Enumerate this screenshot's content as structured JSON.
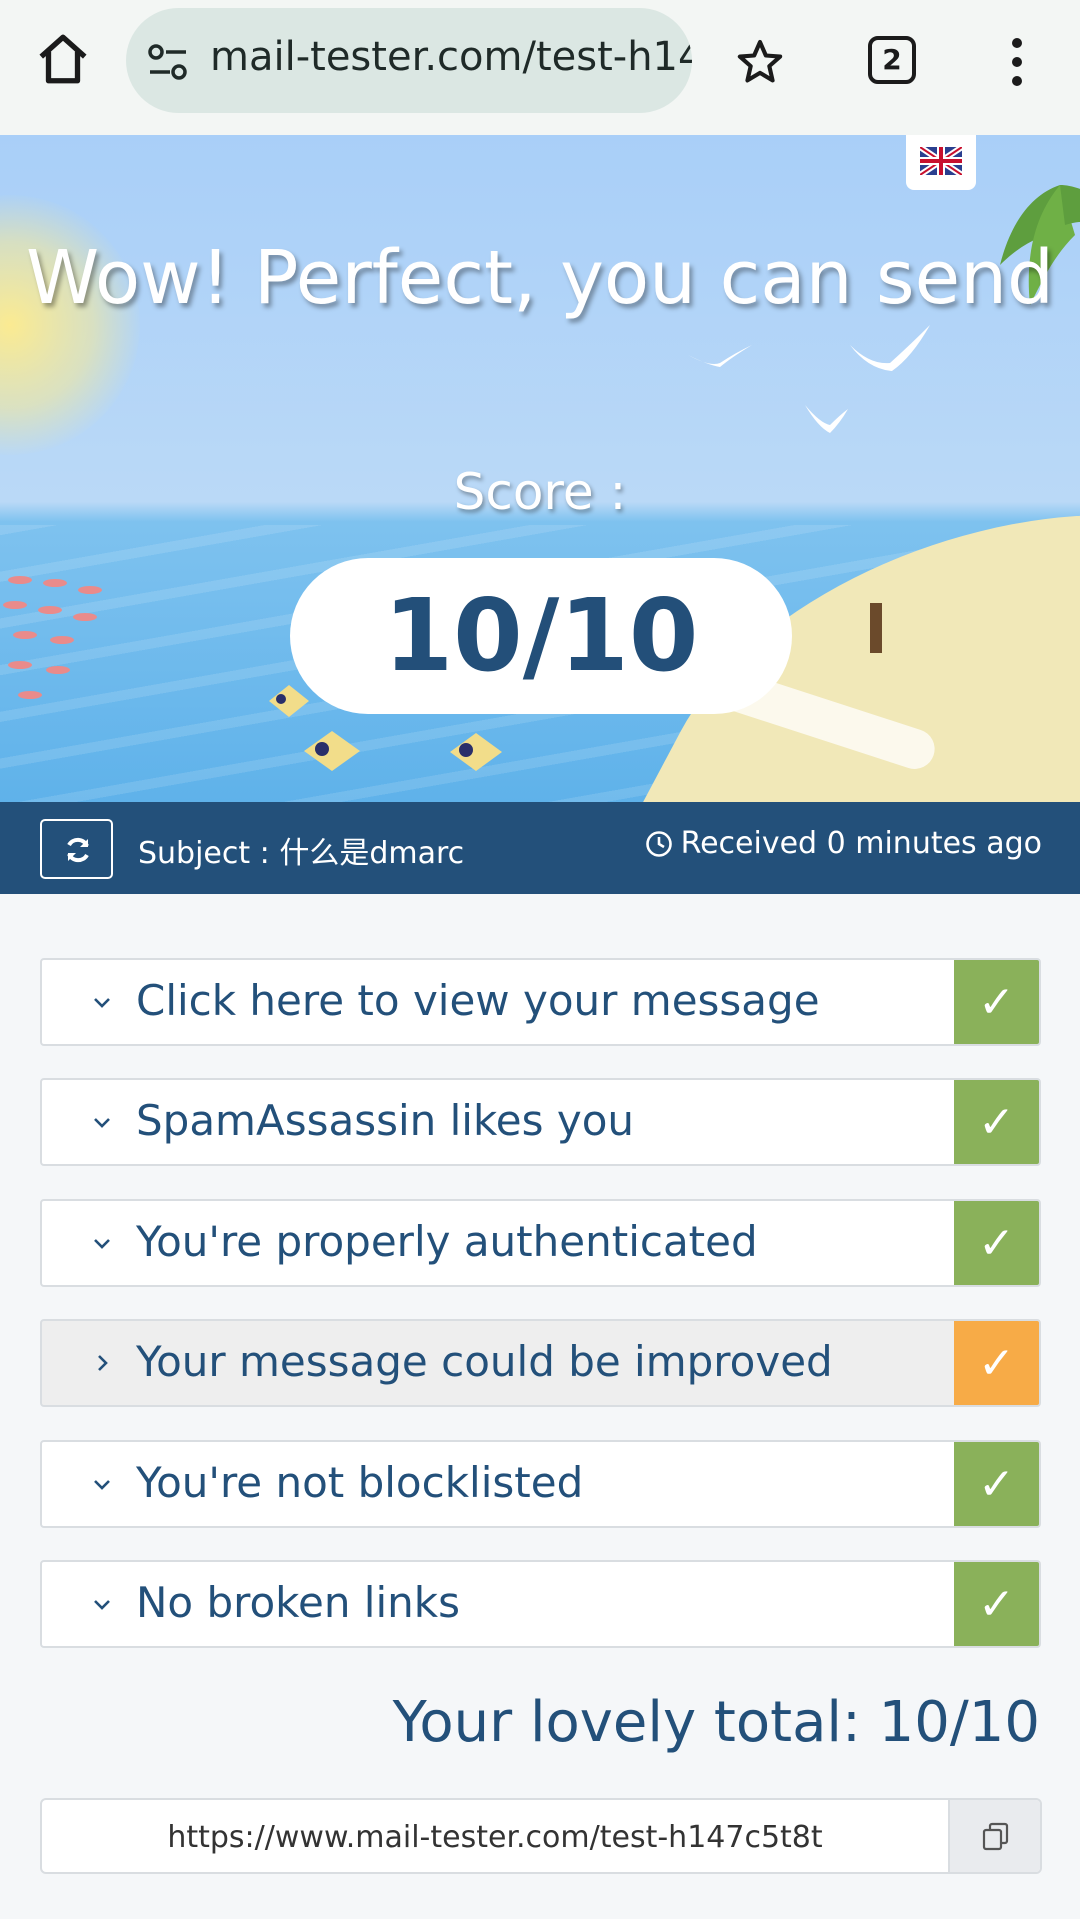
{
  "browser": {
    "url": "mail-tester.com/test-h14",
    "tab_count": "2"
  },
  "hero": {
    "headline": "Wow! Perfect, you can send",
    "score_label": "Score :",
    "score": "10/10"
  },
  "subject_bar": {
    "subject": "Subject : 什么是dmarc",
    "received": "Received 0 minutes ago"
  },
  "results": [
    {
      "label": "Click here to view your message",
      "status": "pass",
      "status_color": "#8ab15a",
      "expanded": true
    },
    {
      "label": "SpamAssassin likes you",
      "status": "pass",
      "status_color": "#8ab15a",
      "expanded": true
    },
    {
      "label": "You're properly authenticated",
      "status": "pass",
      "status_color": "#8ab15a",
      "expanded": true
    },
    {
      "label": "Your message could be improved",
      "status": "warning",
      "status_color": "#f7ab47",
      "expanded": false
    },
    {
      "label": "You're not blocklisted",
      "status": "pass",
      "status_color": "#8ab15a",
      "expanded": true
    },
    {
      "label": "No broken links",
      "status": "pass",
      "status_color": "#8ab15a",
      "expanded": true
    }
  ],
  "status_check_glyph": "✓",
  "total": "Your lovely total: 10/10",
  "share_link": "https://www.mail-tester.com/test-h147c5t8t",
  "colors": {
    "brand_blue": "#23507a",
    "pass_green": "#8ab15a",
    "warn_orange": "#f7ab47"
  }
}
